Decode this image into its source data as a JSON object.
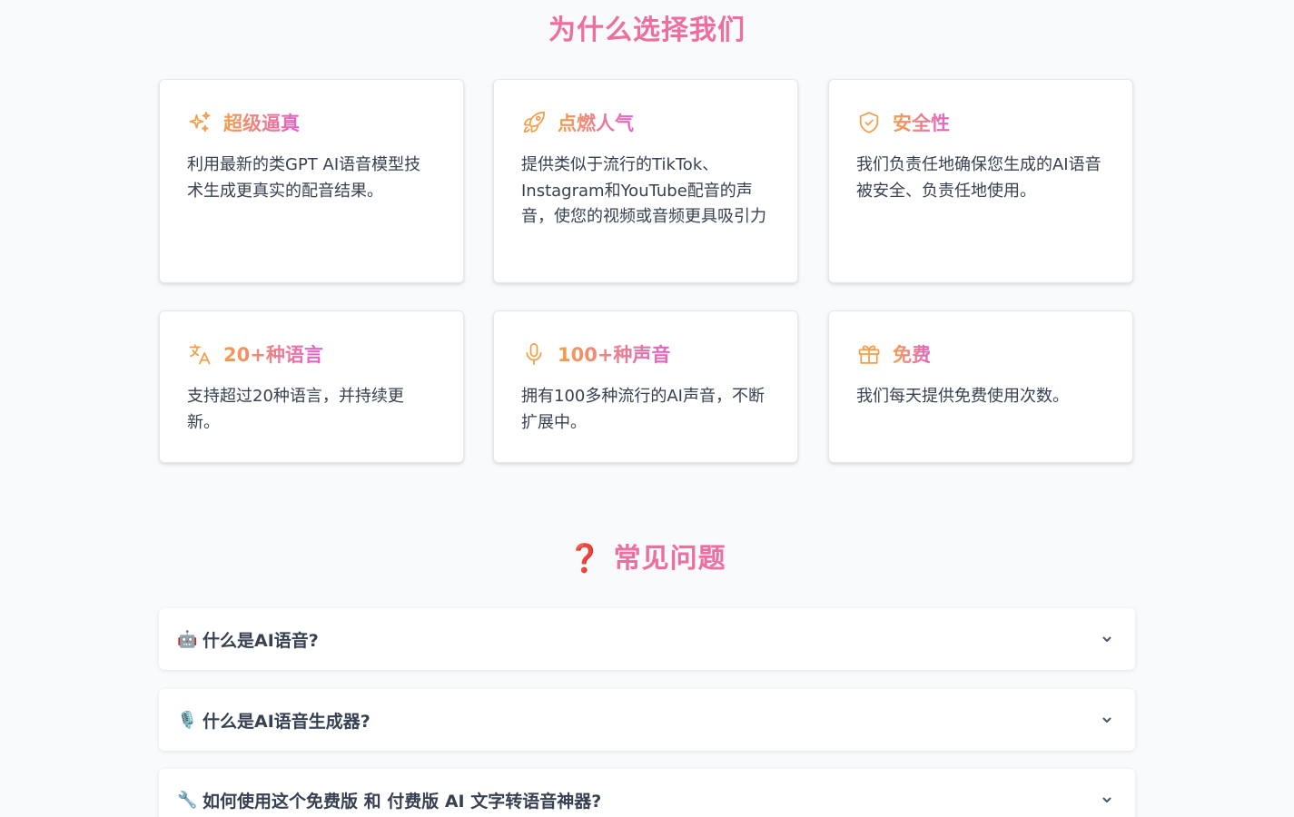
{
  "why": {
    "title": "为什么选择我们",
    "cards": [
      {
        "title": "超级逼真",
        "icon": "sparkles-icon",
        "desc": "利用最新的类GPT AI语音模型技术生成更真实的配音结果。"
      },
      {
        "title": "点燃人气",
        "icon": "rocket-icon",
        "desc": "提供类似于流行的TikTok、Instagram和YouTube配音的声音，使您的视频或音频更具吸引力"
      },
      {
        "title": "安全性",
        "icon": "shield-check-icon",
        "desc": "我们负责任地确保您生成的AI语音被安全、负责任地使用。"
      },
      {
        "title": "20+种语言",
        "icon": "translate-icon",
        "desc": "支持超过20种语言，并持续更新。"
      },
      {
        "title": "100+种声音",
        "icon": "microphone-icon",
        "desc": "拥有100多种流行的AI声音，不断扩展中。"
      },
      {
        "title": "免费",
        "icon": "gift-icon",
        "desc": "我们每天提供免费使用次数。"
      }
    ]
  },
  "faq": {
    "title_icon": "❓",
    "title": "常见问题",
    "items": [
      {
        "emoji": "🤖",
        "question": "什么是AI语音?"
      },
      {
        "emoji": "🎙️",
        "question": "什么是AI语音生成器?"
      },
      {
        "emoji": "🔧",
        "question": "如何使用这个免费版 和 付费版 AI 文字转语音神器?"
      }
    ]
  },
  "colors": {
    "title_pink": "#ec6fa0",
    "gradient_start": "#f59e4a",
    "gradient_end": "#e461c9",
    "icon_orange": "#f59e4a",
    "text_gray": "#374151"
  }
}
